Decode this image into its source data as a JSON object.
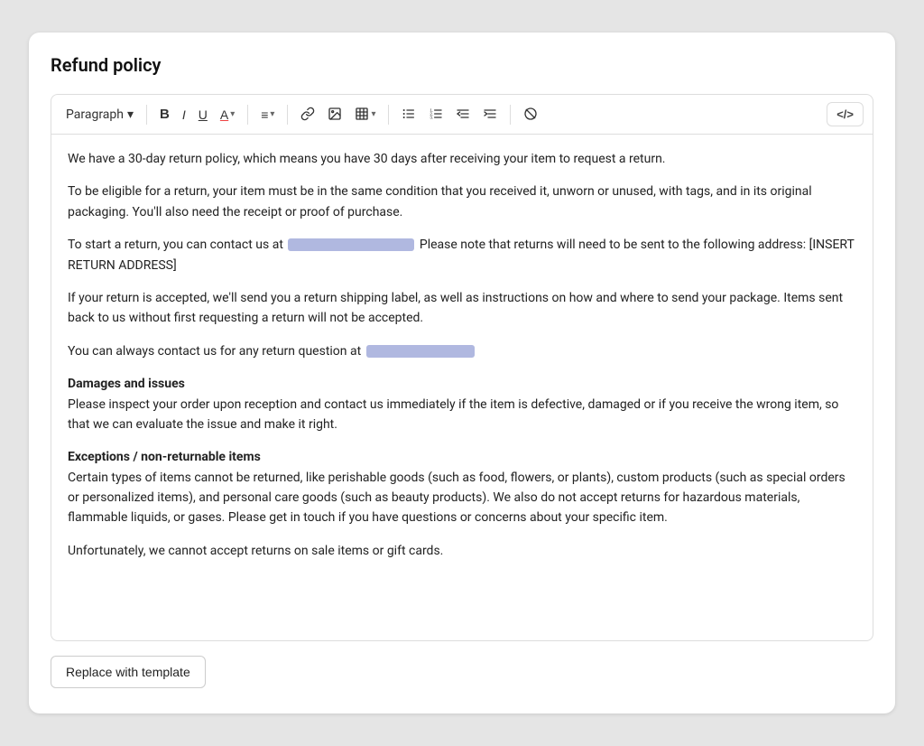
{
  "card": {
    "title": "Refund policy"
  },
  "toolbar": {
    "paragraph_label": "Paragraph",
    "bold_label": "B",
    "italic_label": "I",
    "underline_label": "U",
    "font_color_label": "A",
    "align_label": "≡",
    "link_label": "🔗",
    "image_label": "🖼",
    "table_label": "⊞",
    "bullet_label": "☰",
    "ordered_label": "☷",
    "indent_left_label": "⇤",
    "indent_right_label": "⇥",
    "no_format_label": "⊘",
    "code_label": "</>"
  },
  "content": {
    "para1": "We have a 30-day return policy, which means you have 30 days after receiving your item to request a return.",
    "para2": "To be eligible for a return, your item must be in the same condition that you received it, unworn or unused, with tags, and in its original packaging. You'll also need the receipt or proof of purchase.",
    "para3_prefix": "To start a return, you can contact us at",
    "para3_suffix": "Please note that returns will need to be sent to the following address: [INSERT RETURN ADDRESS]",
    "para4": "If your return is accepted, we'll send you a return shipping label, as well as instructions on how and where to send your package. Items sent back to us without first requesting a return will not be accepted.",
    "para5_prefix": "You can always contact us for any return question at",
    "damages_heading": "Damages and issues",
    "damages_text": "Please inspect your order upon reception and contact us immediately if the item is defective, damaged or if you receive the wrong item, so that we can evaluate the issue and make it right.",
    "exceptions_heading": "Exceptions / non-returnable items",
    "exceptions_text": "Certain types of items cannot be returned, like perishable goods (such as food, flowers, or plants), custom products (such as special orders or personalized items), and personal care goods (such as beauty products). We also do not accept returns for hazardous materials, flammable liquids, or gases. Please get in touch if you have questions or concerns about your specific item.",
    "sale_items_text": "Unfortunately, we cannot accept returns on sale items or gift cards."
  },
  "buttons": {
    "replace_template": "Replace with template"
  }
}
